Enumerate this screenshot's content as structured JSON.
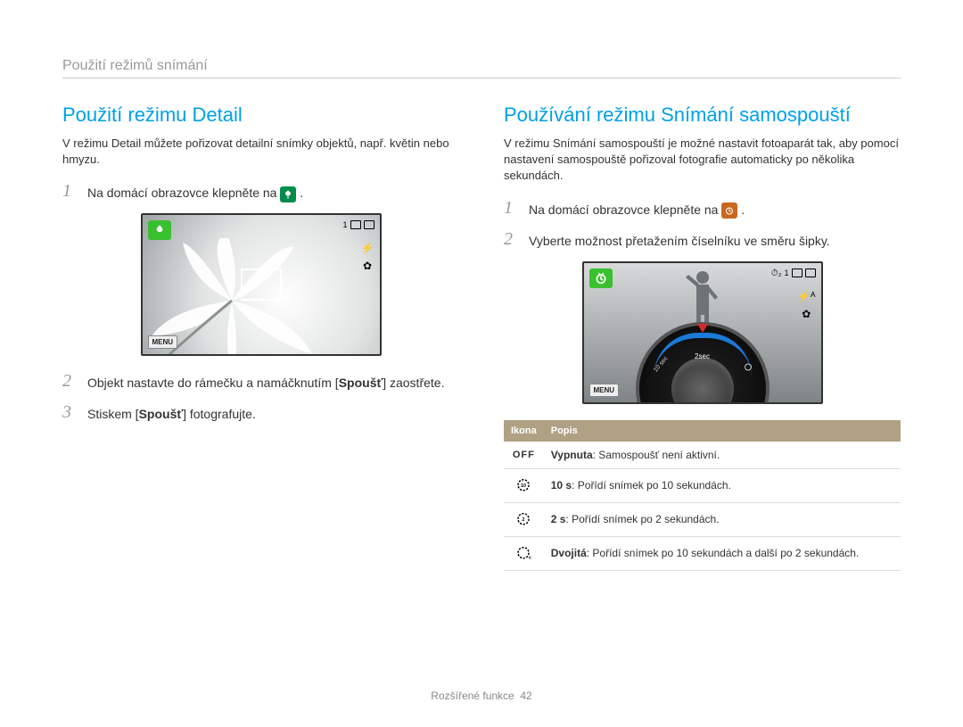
{
  "breadcrumb": "Použití režimů snímání",
  "left": {
    "title": "Použití režimu Detail",
    "intro": "V režimu Detail můžete pořizovat detailní snímky objektů, např. květin nebo hmyzu.",
    "steps": {
      "s1_pre": "Na domácí obrazovce klepněte na ",
      "s1_post": " .",
      "s2_pre": "Objekt nastavte do rámečku a namáčknutím [",
      "s2_bold": "Spoušť",
      "s2_post": "] zaostřete.",
      "s3_pre": "Stiskem [",
      "s3_bold": "Spoušť",
      "s3_post": "] fotografujte."
    },
    "screen": {
      "menu": "MENU",
      "count": "1"
    }
  },
  "right": {
    "title": "Používání režimu Snímání samospouští",
    "intro": "V režimu Snímání samospouští je možné nastavit fotoaparát tak, aby pomocí nastavení samospouště pořizoval fotografie automaticky po několika sekundách.",
    "steps": {
      "s1_pre": "Na domácí obrazovce klepněte na ",
      "s1_post": " .",
      "s2": "Vyberte možnost přetažením číselníku ve směru šipky."
    },
    "screen": {
      "menu": "MENU",
      "count": "1",
      "sel": "2sec",
      "opt_l": "10 sec"
    },
    "table": {
      "h1": "Ikona",
      "h2": "Popis",
      "rows": [
        {
          "icon_label": "OFF",
          "b": "Vypnuta",
          "t": ": Samospoušť není aktivní."
        },
        {
          "icon_label": "⏱10",
          "b": "10 s",
          "t": ": Pořídí snímek po 10 sekundách."
        },
        {
          "icon_label": "⏱2",
          "b": "2 s",
          "t": ": Pořídí snímek po 2 sekundách."
        },
        {
          "icon_label": "⏱⏱",
          "b": "Dvojitá",
          "t": ": Pořídí snímek po 10 sekundách a další po 2 sekundách."
        }
      ]
    }
  },
  "footer": {
    "section": "Rozšířené funkce",
    "page": "42"
  }
}
